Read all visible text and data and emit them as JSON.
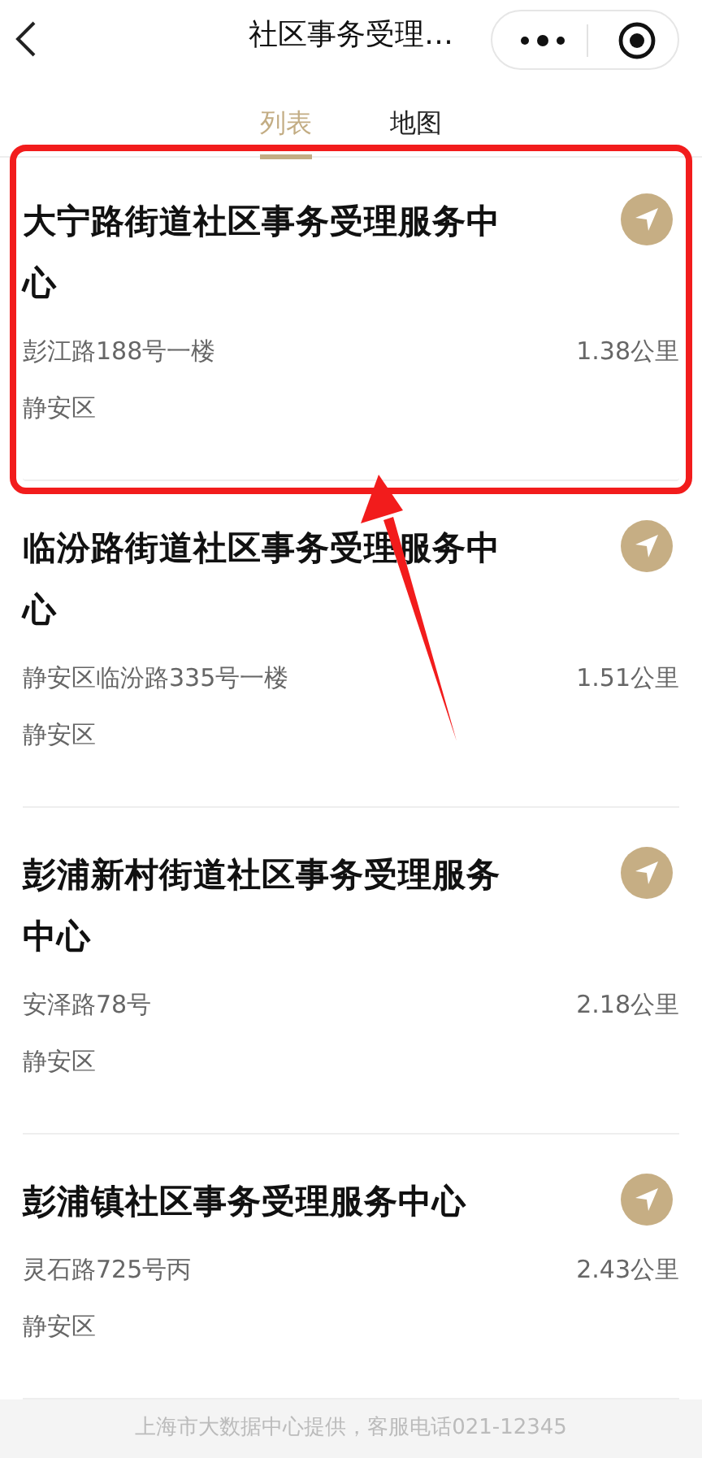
{
  "header": {
    "title": "社区事务受理…"
  },
  "tabs": [
    {
      "label": "列表",
      "selected": true
    },
    {
      "label": "地图",
      "selected": false
    }
  ],
  "centers": [
    {
      "name": "大宁路街道社区事务受理服务中心",
      "address": "彭江路188号一楼",
      "distance": "1.38公里",
      "district": "静安区",
      "highlighted": true
    },
    {
      "name": "临汾路街道社区事务受理服务中心",
      "address": "静安区临汾路335号一楼",
      "distance": "1.51公里",
      "district": "静安区",
      "highlighted": false
    },
    {
      "name": "彭浦新村街道社区事务受理服务中心",
      "address": "安泽路78号",
      "distance": "2.18公里",
      "district": "静安区",
      "highlighted": false
    },
    {
      "name": "彭浦镇社区事务受理服务中心",
      "address": "灵石路725号丙",
      "distance": "2.43公里",
      "district": "静安区",
      "highlighted": false
    }
  ],
  "footer": "上海市大数据中心提供，客服电话021-12345"
}
